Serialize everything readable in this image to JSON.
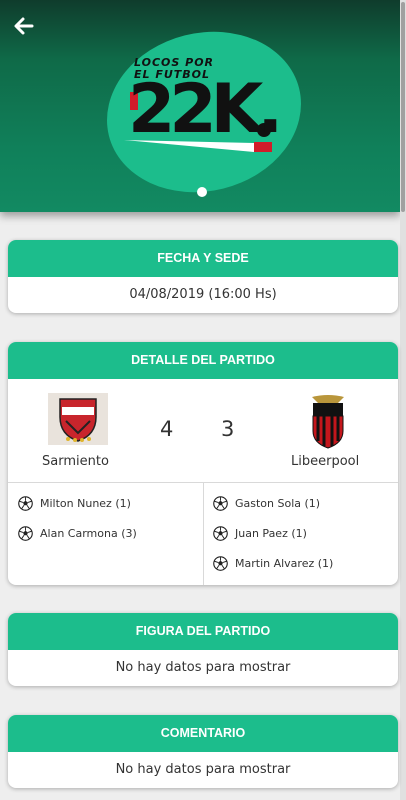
{
  "header": {
    "back_icon": "arrow-left-icon",
    "logo": {
      "line1": "LOCOS POR",
      "line2": "EL FUTBOL",
      "big": "22K."
    },
    "carousel_active_index": 0
  },
  "colors": {
    "accent": "#1cbd8c",
    "header_dark": "#0f6a48",
    "text": "#333333"
  },
  "fecha": {
    "title": "FECHA Y SEDE",
    "value": "04/08/2019 (16:00 Hs)"
  },
  "detalle": {
    "title": "DETALLE DEL PARTIDO",
    "home": {
      "name": "Sarmiento",
      "score": "4",
      "scorers": [
        "Milton Nunez (1)",
        "Alan Carmona (3)"
      ]
    },
    "away": {
      "name": "Libeerpool",
      "score": "3",
      "scorers": [
        "Gaston Sola (1)",
        "Juan Paez (1)",
        "Martin Alvarez (1)"
      ]
    }
  },
  "figura": {
    "title": "FIGURA DEL PARTIDO",
    "value": "No hay datos para mostrar"
  },
  "comentario": {
    "title": "COMENTARIO",
    "value": "No hay datos para mostrar"
  }
}
